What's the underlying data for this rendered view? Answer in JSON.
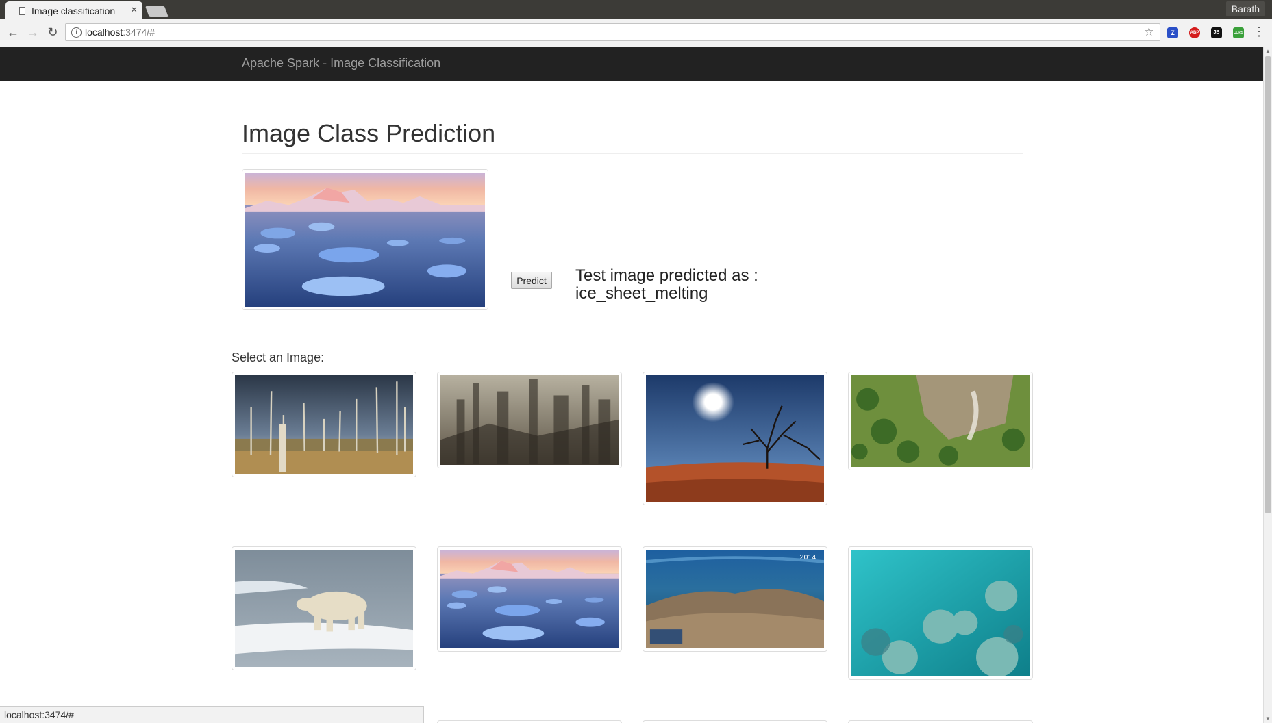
{
  "browser": {
    "tab_title": "Image classification",
    "tab_close": "×",
    "profile_name": "Barath",
    "url_host": "localhost",
    "url_rest": ":3474/#",
    "back_glyph": "←",
    "forward_glyph": "→",
    "reload_glyph": "↻",
    "star_glyph": "☆",
    "menu_glyph": "⋮",
    "info_glyph": "i",
    "extensions": [
      {
        "icon": "zotero-extension-icon",
        "text": "Z",
        "color": "#2a4fc7"
      },
      {
        "icon": "adblock-plus-icon",
        "text": "ABP",
        "color": "#d41c1c"
      },
      {
        "icon": "jetbrains-extension-icon",
        "text": "JB",
        "color": "#111111"
      },
      {
        "icon": "cors-extension-icon",
        "text": "CORS",
        "color": "#3aa03a"
      }
    ],
    "status_url": "localhost:3474/#"
  },
  "app": {
    "brand": "Apache Spark - Image Classification",
    "heading": "Image Class Prediction",
    "predict_label": "Predict",
    "result_line1": "Test image predicted as :",
    "result_line2": "ice_sheet_melting",
    "select_label": "Select an Image:",
    "selected_image": "icebergs",
    "gallery": [
      {
        "image": "dead-forest"
      },
      {
        "image": "smog-city"
      },
      {
        "image": "drought-desert"
      },
      {
        "image": "deforestation-hillside"
      },
      {
        "image": "polar-bear-on-ice"
      },
      {
        "image": "icebergs"
      },
      {
        "image": "coral-reef-bleached",
        "badge": "2014"
      },
      {
        "image": "coral-reef-turquoise"
      }
    ]
  },
  "colors": {
    "navbar": "#222222",
    "brand_text": "#9d9d9d",
    "chrome_dark": "#3c3b37"
  }
}
